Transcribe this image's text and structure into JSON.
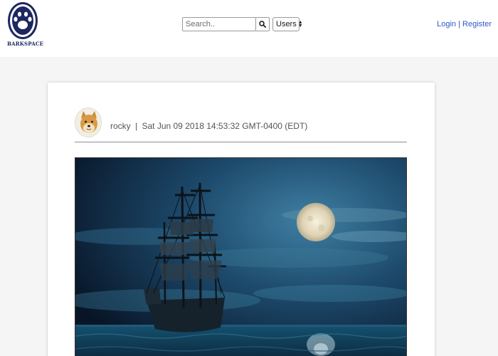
{
  "brand": {
    "name": "BARKSPACE",
    "logo_color": "#1d2760"
  },
  "search": {
    "placeholder": "Search..",
    "icon": "search-icon"
  },
  "filter": {
    "selected": "Users",
    "icon": "sort-arrows-icon"
  },
  "auth": {
    "login": "Login",
    "separator": "|",
    "register": "Register",
    "link_color": "#2d58c8"
  },
  "post": {
    "author": "rocky",
    "separator": "|",
    "timestamp": "Sat Jun 09 2018 14:53:32 GMT-0400 (EDT)"
  }
}
